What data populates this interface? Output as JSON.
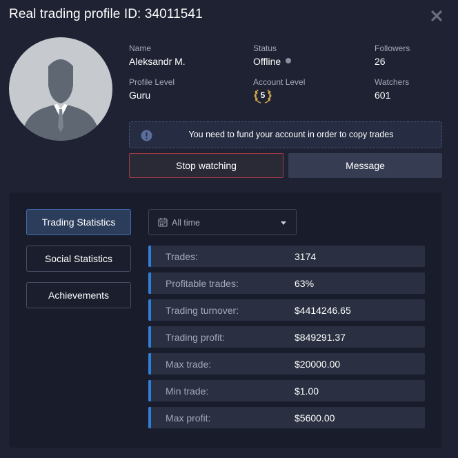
{
  "header": {
    "title": "Real trading profile ID: 34011541"
  },
  "profile": {
    "name_label": "Name",
    "name_value": "Aleksandr M.",
    "status_label": "Status",
    "status_value": "Offline",
    "followers_label": "Followers",
    "followers_value": "26",
    "profile_level_label": "Profile Level",
    "profile_level_value": "Guru",
    "account_level_label": "Account Level",
    "account_level_value": "5",
    "watchers_label": "Watchers",
    "watchers_value": "601"
  },
  "notice": {
    "text": "You need to fund your account in order to copy trades"
  },
  "actions": {
    "stop_label": "Stop watching",
    "message_label": "Message"
  },
  "tabs": [
    {
      "label": "Trading Statistics",
      "active": true
    },
    {
      "label": "Social Statistics",
      "active": false
    },
    {
      "label": "Achievements",
      "active": false
    }
  ],
  "filter": {
    "selected": "All time"
  },
  "stats": [
    {
      "label": "Trades:",
      "value": "3174"
    },
    {
      "label": "Profitable trades:",
      "value": "63%"
    },
    {
      "label": "Trading turnover:",
      "value": "$4414246.65"
    },
    {
      "label": "Trading profit:",
      "value": "$849291.37"
    },
    {
      "label": "Max trade:",
      "value": "$20000.00"
    },
    {
      "label": "Min trade:",
      "value": "$1.00"
    },
    {
      "label": "Max profit:",
      "value": "$5600.00"
    }
  ],
  "colors": {
    "accent": "#2f7ed8",
    "stop_border": "#a33a44",
    "active_tab": "#2c3c5b"
  }
}
